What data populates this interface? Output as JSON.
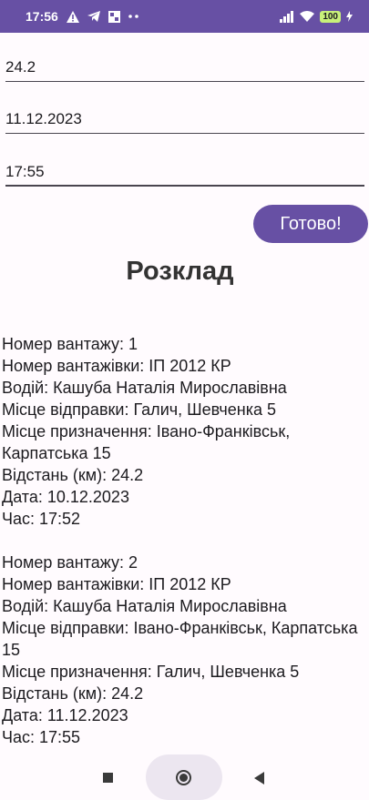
{
  "status_bar": {
    "time": "17:56",
    "left_icons": [
      "warning-icon",
      "telegram-icon",
      "gallery-icon",
      "more-dots-icon"
    ],
    "battery": "100"
  },
  "form": {
    "distance_value": "24.2",
    "date_value": "11.12.2023",
    "time_value": "17:55",
    "done_label": "Готово!"
  },
  "schedule": {
    "title": "Розклад",
    "entries": [
      {
        "cargo_number": "Номер вантажу: 1",
        "truck_number": "Номер вантажівки: ІП 2012 КР",
        "driver": "Водій: Кашуба Наталія Мирославівна",
        "departure": "Місце відправки: Галич, Шевченка 5",
        "destination": "Місце призначення: Івано-Франківськ, Карпатська 15",
        "distance": "Відстань (км): 24.2",
        "date": "Дата: 10.12.2023",
        "time": "Час: 17:52"
      },
      {
        "cargo_number": "Номер вантажу: 2",
        "truck_number": "Номер вантажівки: ІП 2012 КР",
        "driver": "Водій: Кашуба Наталія Мирославівна",
        "departure": "Місце відправки: Івано-Франківськ, Карпатська 15",
        "destination": "Місце призначення: Галич, Шевченка 5",
        "distance": "Відстань (км): 24.2",
        "date": "Дата: 11.12.2023",
        "time": "Час: 17:55"
      }
    ]
  },
  "colors": {
    "primary": "#6750a4",
    "background": "#fffbfe",
    "text": "#1c1b1f"
  }
}
